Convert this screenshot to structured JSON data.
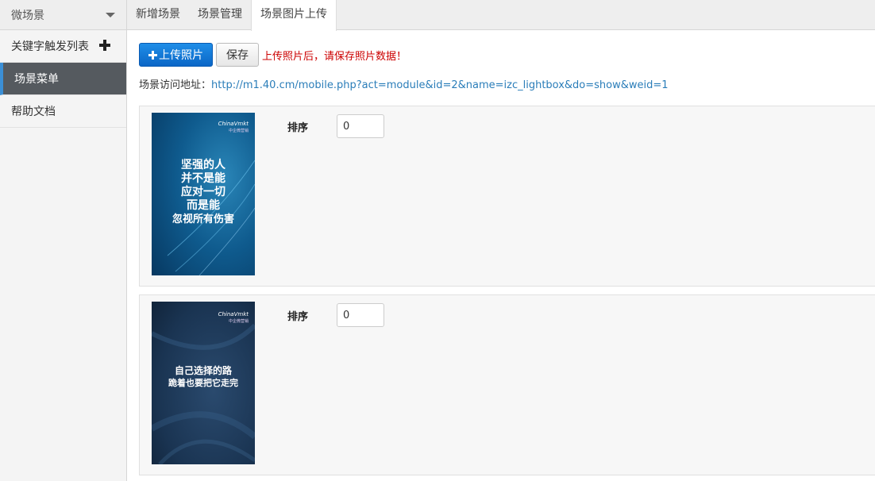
{
  "sidebar": {
    "header": "微场景",
    "items": [
      {
        "label": "关键字触发列表"
      },
      {
        "label": "场景菜单"
      },
      {
        "label": "帮助文档"
      }
    ]
  },
  "tabs": [
    {
      "label": "新增场景"
    },
    {
      "label": "场景管理"
    },
    {
      "label": "场景图片上传"
    }
  ],
  "toolbar": {
    "upload_label": "上传照片",
    "save_label": "保存",
    "warning": "上传照片后，请保存照片数据！"
  },
  "url": {
    "label": "场景访问地址：",
    "link": "http://m1.40.cm/mobile.php?act=module&id=2&name=izc_lightbox&do=show&weid=1"
  },
  "photos": [
    {
      "sort_label": "排序",
      "sort_value": "0",
      "brand": "ChinaVmkt",
      "brand_sub": "中企微营销",
      "lines": [
        "坚强的人",
        "并不是能",
        "应对一切",
        "而是能",
        "忽视所有伤害"
      ]
    },
    {
      "sort_label": "排序",
      "sort_value": "0",
      "brand": "ChinaVmkt",
      "brand_sub": "中企微营销",
      "lines": [
        "自己选择的路",
        "跪着也要把它走完"
      ]
    }
  ],
  "colors": {
    "accent": "#0b66c6",
    "warning": "#cc0000",
    "link": "#2a7db9",
    "sidebar_active": "#555a5f"
  }
}
